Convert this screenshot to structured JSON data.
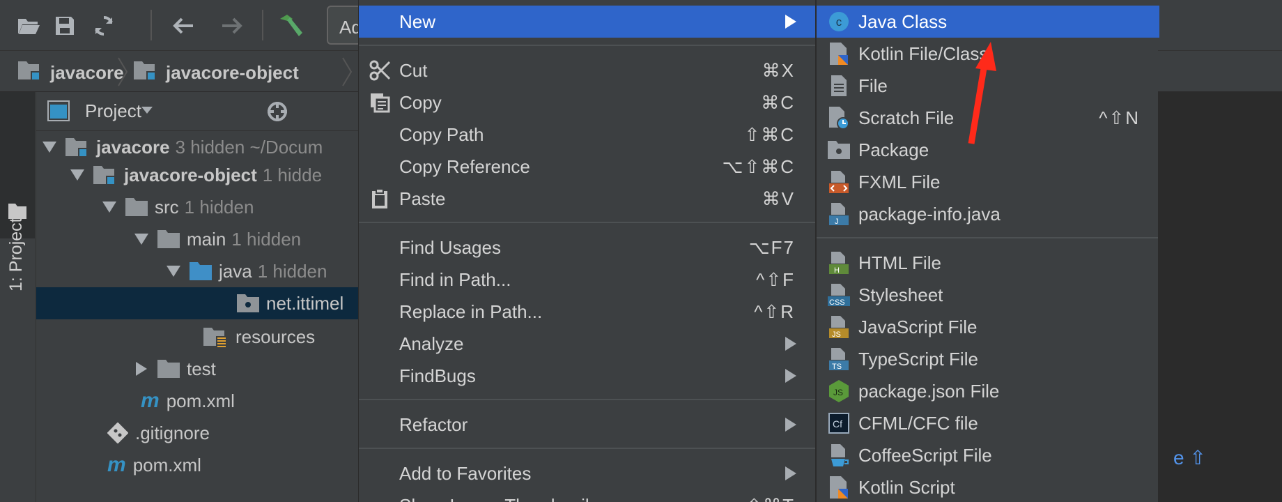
{
  "toolbar": {
    "buttons": [
      "open-folder",
      "save-all",
      "sync",
      "back",
      "forward",
      "build"
    ],
    "config_combo_text": "Ad"
  },
  "breadcrumb": {
    "items": [
      "javacore",
      "javacore-object"
    ]
  },
  "tool_window_tab": "1: Project",
  "project_panel": {
    "title": "Project",
    "tree": [
      {
        "name": "javacore",
        "hint": "3 hidden  ~/Docum"
      },
      {
        "name": "javacore-object",
        "hint": "1 hidde"
      },
      {
        "name": "src",
        "hint": "1 hidden"
      },
      {
        "name": "main",
        "hint": "1 hidden"
      },
      {
        "name": "java",
        "hint": "1 hidden"
      },
      {
        "name": "net.ittimel",
        "hint": ""
      },
      {
        "name": "resources",
        "hint": ""
      },
      {
        "name": "test",
        "hint": ""
      },
      {
        "name": "pom.xml",
        "hint": ""
      },
      {
        "name": ".gitignore",
        "hint": ""
      },
      {
        "name": "pom.xml",
        "hint": ""
      }
    ]
  },
  "context_menu": {
    "items": [
      {
        "label": "New",
        "shortcut": ""
      },
      {
        "label": "Cut",
        "shortcut": "⌘X"
      },
      {
        "label": "Copy",
        "shortcut": "⌘C"
      },
      {
        "label": "Copy Path",
        "shortcut": "⇧⌘C"
      },
      {
        "label": "Copy Reference",
        "shortcut": "⌥⇧⌘C"
      },
      {
        "label": "Paste",
        "shortcut": "⌘V"
      },
      {
        "label": "Find Usages",
        "shortcut": "⌥F7"
      },
      {
        "label": "Find in Path...",
        "shortcut": "^⇧F"
      },
      {
        "label": "Replace in Path...",
        "shortcut": "^⇧R"
      },
      {
        "label": "Analyze",
        "shortcut": ""
      },
      {
        "label": "FindBugs",
        "shortcut": ""
      },
      {
        "label": "Refactor",
        "shortcut": ""
      },
      {
        "label": "Add to Favorites",
        "shortcut": ""
      },
      {
        "label": "Show Image Thumbnails",
        "shortcut": "⇧⌘T"
      }
    ]
  },
  "new_submenu": {
    "items": [
      {
        "label": "Java Class",
        "shortcut": ""
      },
      {
        "label": "Kotlin File/Class",
        "shortcut": ""
      },
      {
        "label": "File",
        "shortcut": ""
      },
      {
        "label": "Scratch File",
        "shortcut": "^⇧N"
      },
      {
        "label": "Package",
        "shortcut": ""
      },
      {
        "label": "FXML File",
        "shortcut": ""
      },
      {
        "label": "package-info.java",
        "shortcut": ""
      },
      {
        "label": "HTML File",
        "shortcut": ""
      },
      {
        "label": "Stylesheet",
        "shortcut": ""
      },
      {
        "label": "JavaScript File",
        "shortcut": ""
      },
      {
        "label": "TypeScript File",
        "shortcut": ""
      },
      {
        "label": "package.json File",
        "shortcut": ""
      },
      {
        "label": "CFML/CFC file",
        "shortcut": ""
      },
      {
        "label": "CoffeeScript File",
        "shortcut": ""
      },
      {
        "label": "Kotlin Script",
        "shortcut": ""
      }
    ]
  },
  "editor": {
    "hint_text": "e ⇧"
  },
  "colors": {
    "background": "#2b2b2b",
    "panel": "#3c3f41",
    "highlight": "#2f65ca",
    "selection": "#0d293e",
    "annotation_arrow": "#ff2a1a"
  }
}
